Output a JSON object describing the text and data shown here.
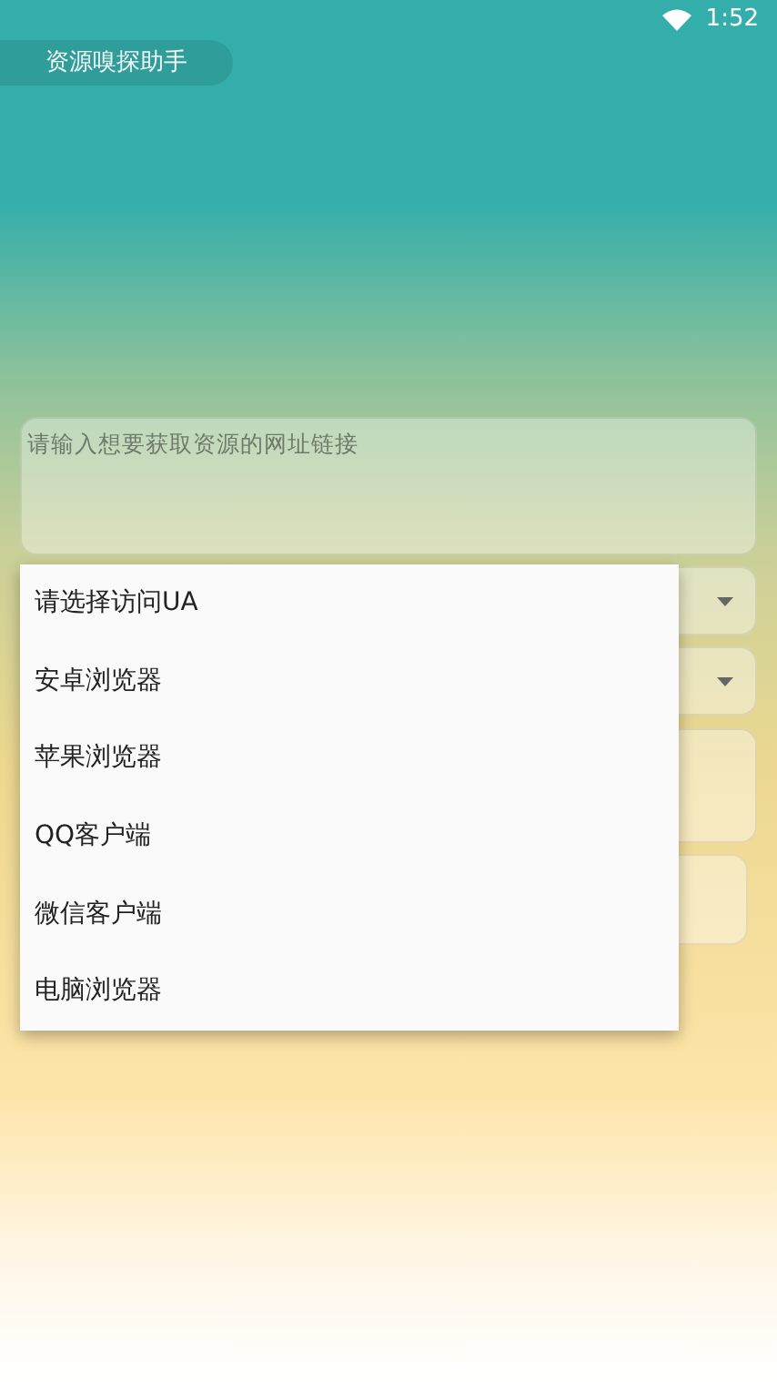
{
  "status_bar": {
    "time": "1:52"
  },
  "app_title": "资源嗅探助手",
  "url_field": {
    "placeholder": "请输入想要获取资源的网址链接"
  },
  "controls": [
    {
      "kind": "select"
    },
    {
      "kind": "select"
    },
    {
      "kind": "box"
    },
    {
      "kind": "box"
    }
  ],
  "dropdown_menu": {
    "items": [
      {
        "label": "请选择访问UA"
      },
      {
        "label": "安卓浏览器"
      },
      {
        "label": "苹果浏览器"
      },
      {
        "label": "QQ客户端"
      },
      {
        "label": "微信客户端"
      },
      {
        "label": "电脑浏览器"
      }
    ]
  }
}
